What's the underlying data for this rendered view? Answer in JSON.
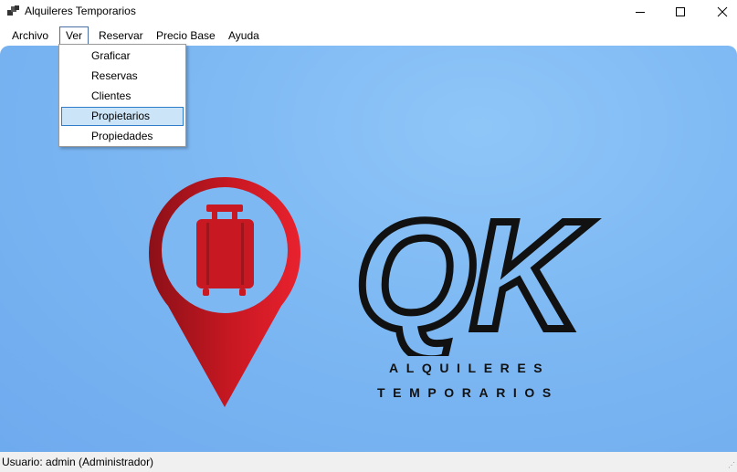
{
  "window": {
    "title": "Alquileres Temporarios",
    "icon": "app-window-icon"
  },
  "menu": {
    "items": [
      {
        "label": "Archivo"
      },
      {
        "label": "Ver"
      },
      {
        "label": "Reservar"
      },
      {
        "label": "Precio Base"
      },
      {
        "label": "Ayuda"
      }
    ],
    "open_menu": "Ver"
  },
  "dropdown": {
    "items": [
      {
        "label": "Graficar"
      },
      {
        "label": "Reservas"
      },
      {
        "label": "Clientes"
      },
      {
        "label": "Propietarios",
        "highlighted": true
      },
      {
        "label": "Propiedades"
      }
    ]
  },
  "logo": {
    "brand": "QK",
    "line1": "ALQUILERES",
    "line2": "TEMPORARIOS",
    "icon": "location-pin-suitcase-icon",
    "colors": {
      "pin": "#d11f2a",
      "pin_dark": "#8c1018",
      "text": "#111111",
      "background": "#7db8f3"
    }
  },
  "status": {
    "text": "Usuario: admin (Administrador)"
  }
}
